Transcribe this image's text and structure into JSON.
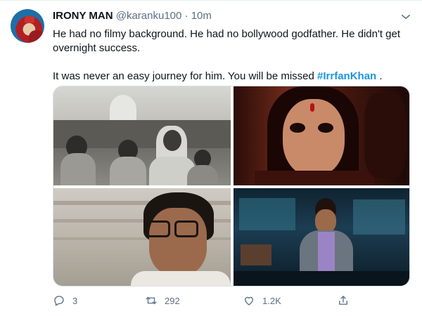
{
  "tweet": {
    "author_name": "IRONY MAN",
    "handle": "@karanku100",
    "separator": "·",
    "time": "10m",
    "text_line1": "He had no filmy background. He had no bollywood godfather. He didn't get overnight success.",
    "text_line2_prefix": "It was never an easy journey for him. You will be missed ",
    "hashtag": "#IrrfanKhan",
    "text_line2_suffix": " ."
  },
  "actions": {
    "reply_count": "3",
    "retweet_count": "292",
    "like_count": "1.2K"
  },
  "icons": {
    "more": "chevron-down-icon",
    "reply": "reply-icon",
    "retweet": "retweet-icon",
    "like": "heart-icon",
    "share": "share-icon"
  },
  "colors": {
    "text": "#0f1419",
    "secondary": "#5b7083",
    "link": "#1b95e0"
  }
}
